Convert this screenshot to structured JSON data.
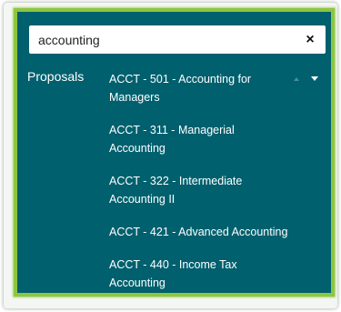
{
  "search": {
    "value": "accounting",
    "clear_label": "×",
    "icon": "close-icon"
  },
  "group": {
    "label": "Proposals"
  },
  "options": [
    "ACCT - 501 - Accounting for Managers",
    "ACCT - 311 - Managerial Accounting",
    "ACCT - 322 - Intermediate Accounting II",
    "ACCT - 421 - Advanced Accounting",
    "ACCT - 440 - Income Tax Accounting"
  ],
  "scroll": {
    "up_icon": "caret-up-icon",
    "down_icon": "caret-down-icon"
  },
  "colors": {
    "panel_background": "#00606e",
    "panel_border": "#8dc63f",
    "text": "#ffffff"
  }
}
